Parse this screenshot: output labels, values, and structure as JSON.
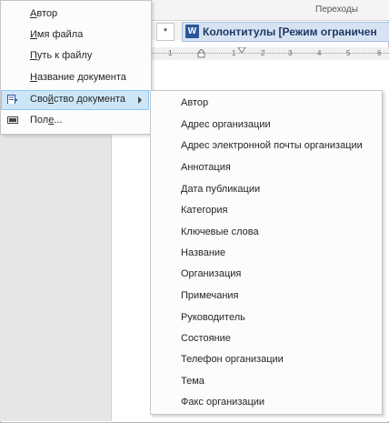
{
  "ribbon": {
    "group_label": "Переходы"
  },
  "tabs": {
    "star_label": "*",
    "document_title": "Колонтитулы [Режим ограничен",
    "word_icon_letter": "W"
  },
  "ruler": {
    "marks": [
      "1",
      "1",
      "2",
      "3",
      "4",
      "5",
      "6"
    ]
  },
  "menu": {
    "items": [
      {
        "label_prefix": "",
        "hotkey": "А",
        "label_rest": "втор"
      },
      {
        "label_prefix": "",
        "hotkey": "И",
        "label_rest": "мя файла"
      },
      {
        "label_prefix": "",
        "hotkey": "П",
        "label_rest": "уть к файлу"
      },
      {
        "label_prefix": "",
        "hotkey": "Н",
        "label_rest": "азвание документа"
      },
      {
        "label_prefix": "Сво",
        "hotkey": "й",
        "label_rest": "ство документа",
        "icon": "document-property-icon",
        "has_submenu": true,
        "active": true
      },
      {
        "label_prefix": "Пол",
        "hotkey": "е",
        "label_rest": "...",
        "icon": "field-icon"
      }
    ]
  },
  "submenu": {
    "items": [
      "Автор",
      "Адрес организации",
      "Адрес электронной почты организации",
      "Аннотация",
      "Дата публикации",
      "Категория",
      "Ключевые слова",
      "Название",
      "Организация",
      "Примечания",
      "Руководитель",
      "Состояние",
      "Телефон организации",
      "Тема",
      "Факс организации"
    ]
  },
  "colors": {
    "highlight": "#cde6f7",
    "highlight_border": "#90c8f6",
    "word_blue": "#2b579a"
  }
}
